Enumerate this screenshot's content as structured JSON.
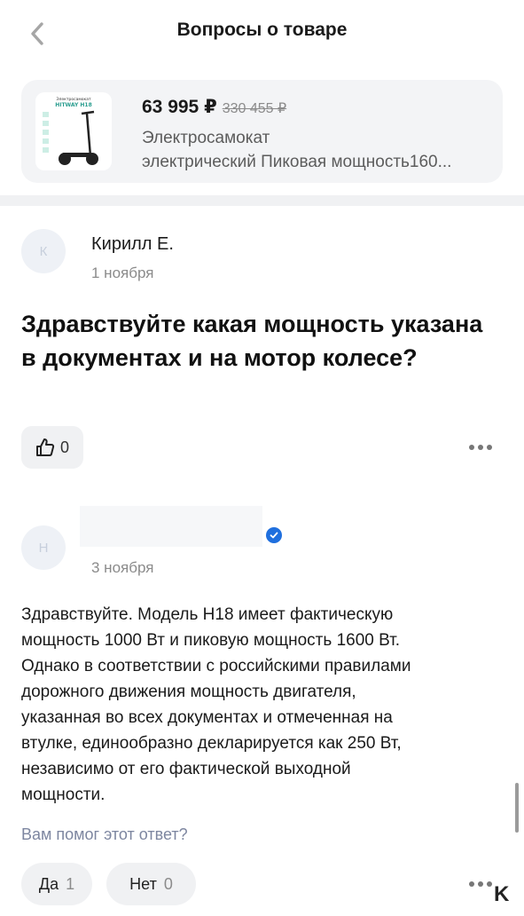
{
  "header": {
    "title": "Вопросы о товаре",
    "back_icon": "chevron-left-icon"
  },
  "product": {
    "price": "63 995 ₽",
    "old_price": "330 455 ₽",
    "name_line1": "Электросамокат",
    "name_line2": "электрический Пиковая мощность160...",
    "thumb_text1": "Электросамокат",
    "thumb_text2": "HITWAY H18"
  },
  "question": {
    "avatar_letter": "К",
    "author": "Кирилл Е.",
    "date": "1 ноября",
    "text": "Здравствуйте какая мощность указана в документах и на мотор колесе?",
    "likes": "0"
  },
  "answer": {
    "avatar_letter": "Н",
    "date": "3 ноября",
    "lines": [
      "Здравствуйте. Модель H18 имеет фактическую",
      "мощность 1000 Вт и пиковую мощность 1600 Вт.",
      "Однако в соответствии с российскими правилами",
      "дорожного движения мощность двигателя,",
      "указанная во всех документах и отмеченная на",
      "втулке, единообразно декларируется как 250 Вт,",
      "независимо от его фактической выходной",
      "мощности."
    ],
    "helpful_label": "Вам помог этот ответ?",
    "yes_label": "Да",
    "yes_count": "1",
    "no_label": "Нет",
    "no_count": "0"
  },
  "corner_logo": "K",
  "colors": {
    "accent_blue": "#1f6fde",
    "link_gray": "#7d86a0",
    "card_bg": "#f3f4f6"
  }
}
